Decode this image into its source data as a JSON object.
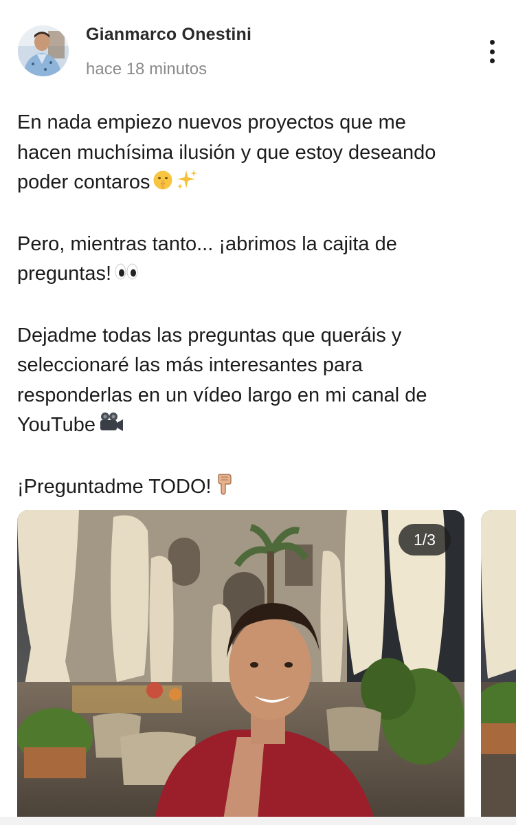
{
  "post": {
    "author": "Gianmarco Onestini",
    "time": "hace 18 minutos",
    "paragraphs": [
      {
        "lines": [
          "En nada empiezo nuevos proyectos que me",
          "hacen muchísima ilusión y que estoy deseando",
          "poder contaros"
        ],
        "emoji": [
          "shushing-face-emoji",
          "sparkles-emoji"
        ]
      },
      {
        "lines": [
          "Pero, mientras tanto... ¡abrimos la cajita de",
          "preguntas!"
        ],
        "emoji": [
          "eyes-emoji"
        ]
      },
      {
        "lines": [
          "Dejadme todas las preguntas que queráis y",
          "seleccionaré las más interesantes para",
          "responderlas en un vídeo largo en mi canal de",
          "YouTube"
        ],
        "emoji": [
          "video-camera-emoji"
        ]
      },
      {
        "lines": [
          "¡Preguntadme TODO!"
        ],
        "emoji": [
          "pointing-down-emoji"
        ]
      }
    ]
  },
  "gallery": {
    "counter": "1/3",
    "current": 1,
    "total": 3
  },
  "icons": {
    "more": "more-vertical-icon"
  },
  "colors": {
    "text": "#1b1b1b",
    "muted": "#8a8a8a",
    "counter_bg": "#1e1e1e",
    "shirt": "#9a1f2a"
  }
}
